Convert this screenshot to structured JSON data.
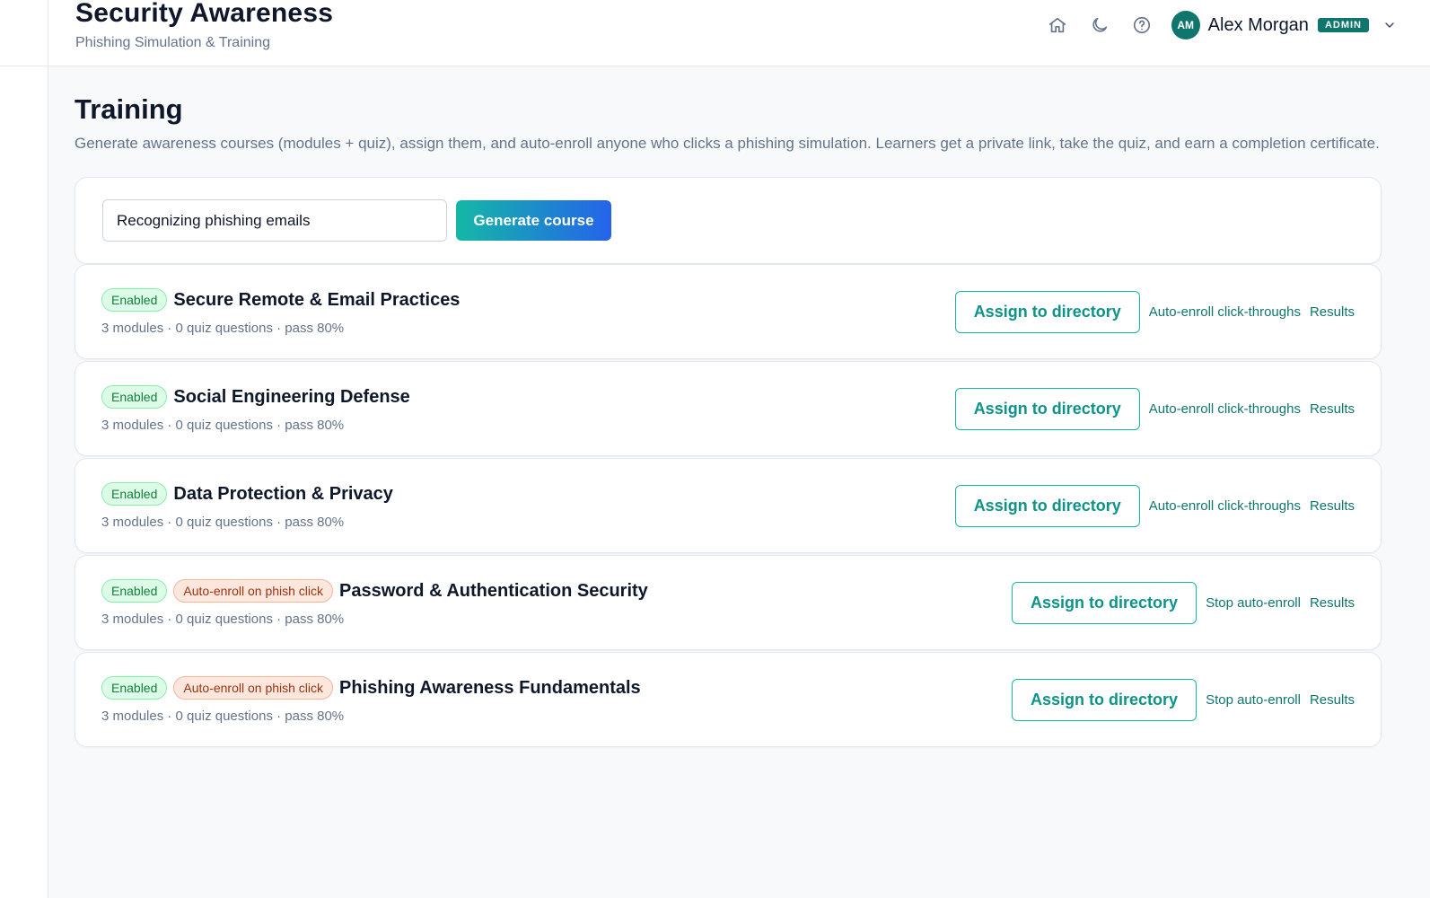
{
  "app": {
    "title": "Security Awareness",
    "subtitle": "Phishing Simulation & Training"
  },
  "header": {
    "icons": [
      "home-icon",
      "moon-icon",
      "help-icon",
      "chevron-down-icon"
    ],
    "user": {
      "initials": "AM",
      "name": "Alex Morgan",
      "role": "ADMIN"
    }
  },
  "page": {
    "title": "Training",
    "description": "Generate awareness courses (modules + quiz), assign them, and auto-enroll anyone who clicks a phishing simulation. Learners get a private link, take the quiz, and earn a completion certificate."
  },
  "generator": {
    "input_value": "Recognizing phishing emails",
    "button_label": "Generate course"
  },
  "courses": [
    {
      "status_badge": "Enabled",
      "title": "Secure Remote & Email Practices",
      "meta": "3 modules · 0 quiz questions · pass 80%",
      "assign_label": "Assign to directory",
      "enroll_link": "Auto-enroll click-throughs",
      "results_link": "Results"
    },
    {
      "status_badge": "Enabled",
      "title": "Social Engineering Defense",
      "meta": "3 modules · 0 quiz questions · pass 80%",
      "assign_label": "Assign to directory",
      "enroll_link": "Auto-enroll click-throughs",
      "results_link": "Results"
    },
    {
      "status_badge": "Enabled",
      "title": "Data Protection & Privacy",
      "meta": "3 modules · 0 quiz questions · pass 80%",
      "assign_label": "Assign to directory",
      "enroll_link": "Auto-enroll click-throughs",
      "results_link": "Results"
    },
    {
      "status_badge": "Enabled",
      "auto_badge": "Auto-enroll on phish click",
      "title": "Password & Authentication Security",
      "meta": "3 modules · 0 quiz questions · pass 80%",
      "assign_label": "Assign to directory",
      "enroll_link": "Stop auto-enroll",
      "results_link": "Results"
    },
    {
      "status_badge": "Enabled",
      "auto_badge": "Auto-enroll on phish click",
      "title": "Phishing Awareness Fundamentals",
      "meta": "3 modules · 0 quiz questions · pass 80%",
      "assign_label": "Assign to directory",
      "enroll_link": "Stop auto-enroll",
      "results_link": "Results"
    }
  ],
  "colors": {
    "accent": "#14b8a6",
    "brand_dark": "#0f766e",
    "gradient_end": "#2563eb",
    "enabled_bg": "#dcfce7",
    "auto_bg": "#fde7dc"
  }
}
